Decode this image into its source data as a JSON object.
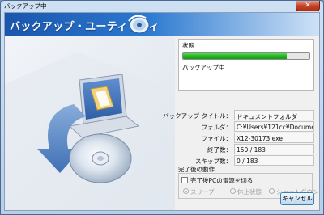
{
  "window": {
    "title": "バックアップ中",
    "close_symbol": "✕"
  },
  "banner": {
    "title": "バックアップ・ユーティリティ"
  },
  "status": {
    "caption": "状態",
    "progress_percent": 82,
    "text": "バックアップ中"
  },
  "details": [
    {
      "label": "バックアップ タイトル：",
      "value": "ドキュメントフォルダ"
    },
    {
      "label": "フォルダ：",
      "value": "C:¥Users¥121cc¥Documen"
    },
    {
      "label": "ファイル：",
      "value": "X12-30173.exe"
    },
    {
      "label": "終了数：",
      "value": "150 / 183"
    },
    {
      "label": "スキップ数：",
      "value": "0 / 183"
    }
  ],
  "after": {
    "caption": "完了後の動作",
    "checkbox_label": "完了後PCの電源を切る",
    "checkbox_checked": false,
    "radios": [
      "スリープ",
      "休止状態",
      "シャットダウン"
    ],
    "radio_selected": 0
  },
  "buttons": {
    "cancel": "キャンセル"
  }
}
